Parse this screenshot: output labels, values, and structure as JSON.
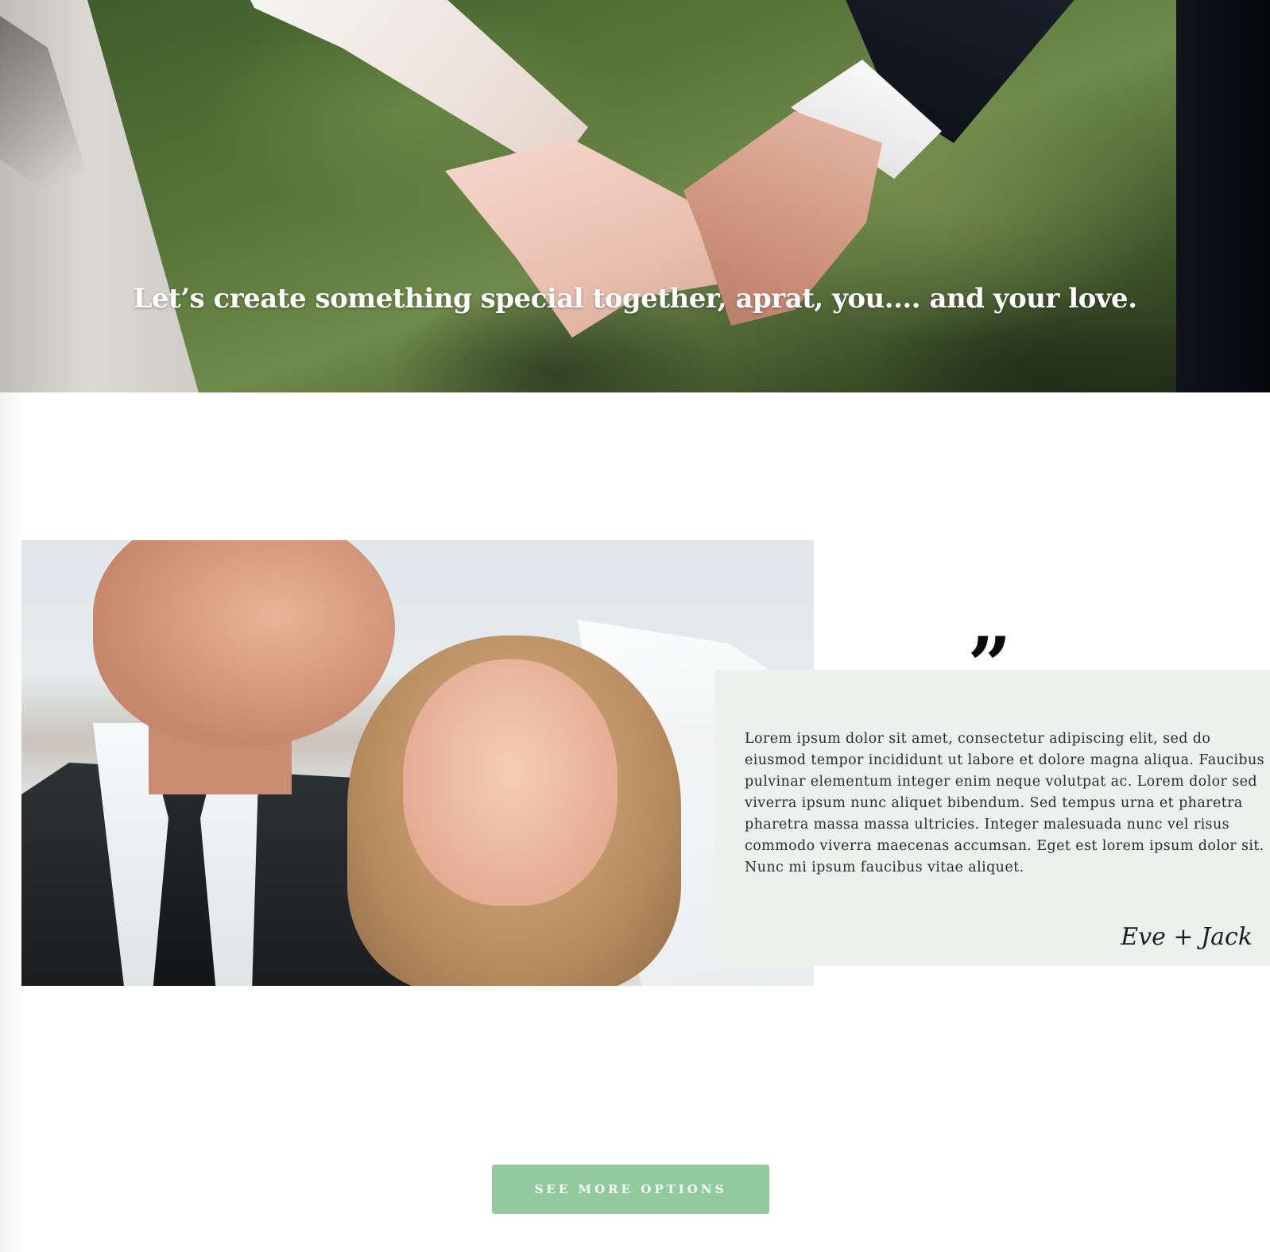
{
  "hero": {
    "title": "Let’s create something special together, aprat, you.... and your love."
  },
  "testimonial": {
    "quote_symbol": "”",
    "text": "Lorem ipsum dolor sit amet, consectetur adipiscing elit, sed do eiusmod tempor incididunt ut labore et dolore magna aliqua. Faucibus pulvinar elementum integer enim neque volutpat ac. Lorem dolor sed viverra ipsum nunc aliquet bibendum. Sed tempus urna et pharetra pharetra massa massa ultricies. Integer malesuada nunc vel risus commodo viverra maecenas accumsan. Eget est lorem ipsum dolor sit. Nunc mi ipsum faucibus vitae aliquet.",
    "signature": "Eve + Jack",
    "card_color": "#edf1ee"
  },
  "cta": {
    "label": "SEE MORE OPTIONS",
    "color": "#91cb9d"
  }
}
